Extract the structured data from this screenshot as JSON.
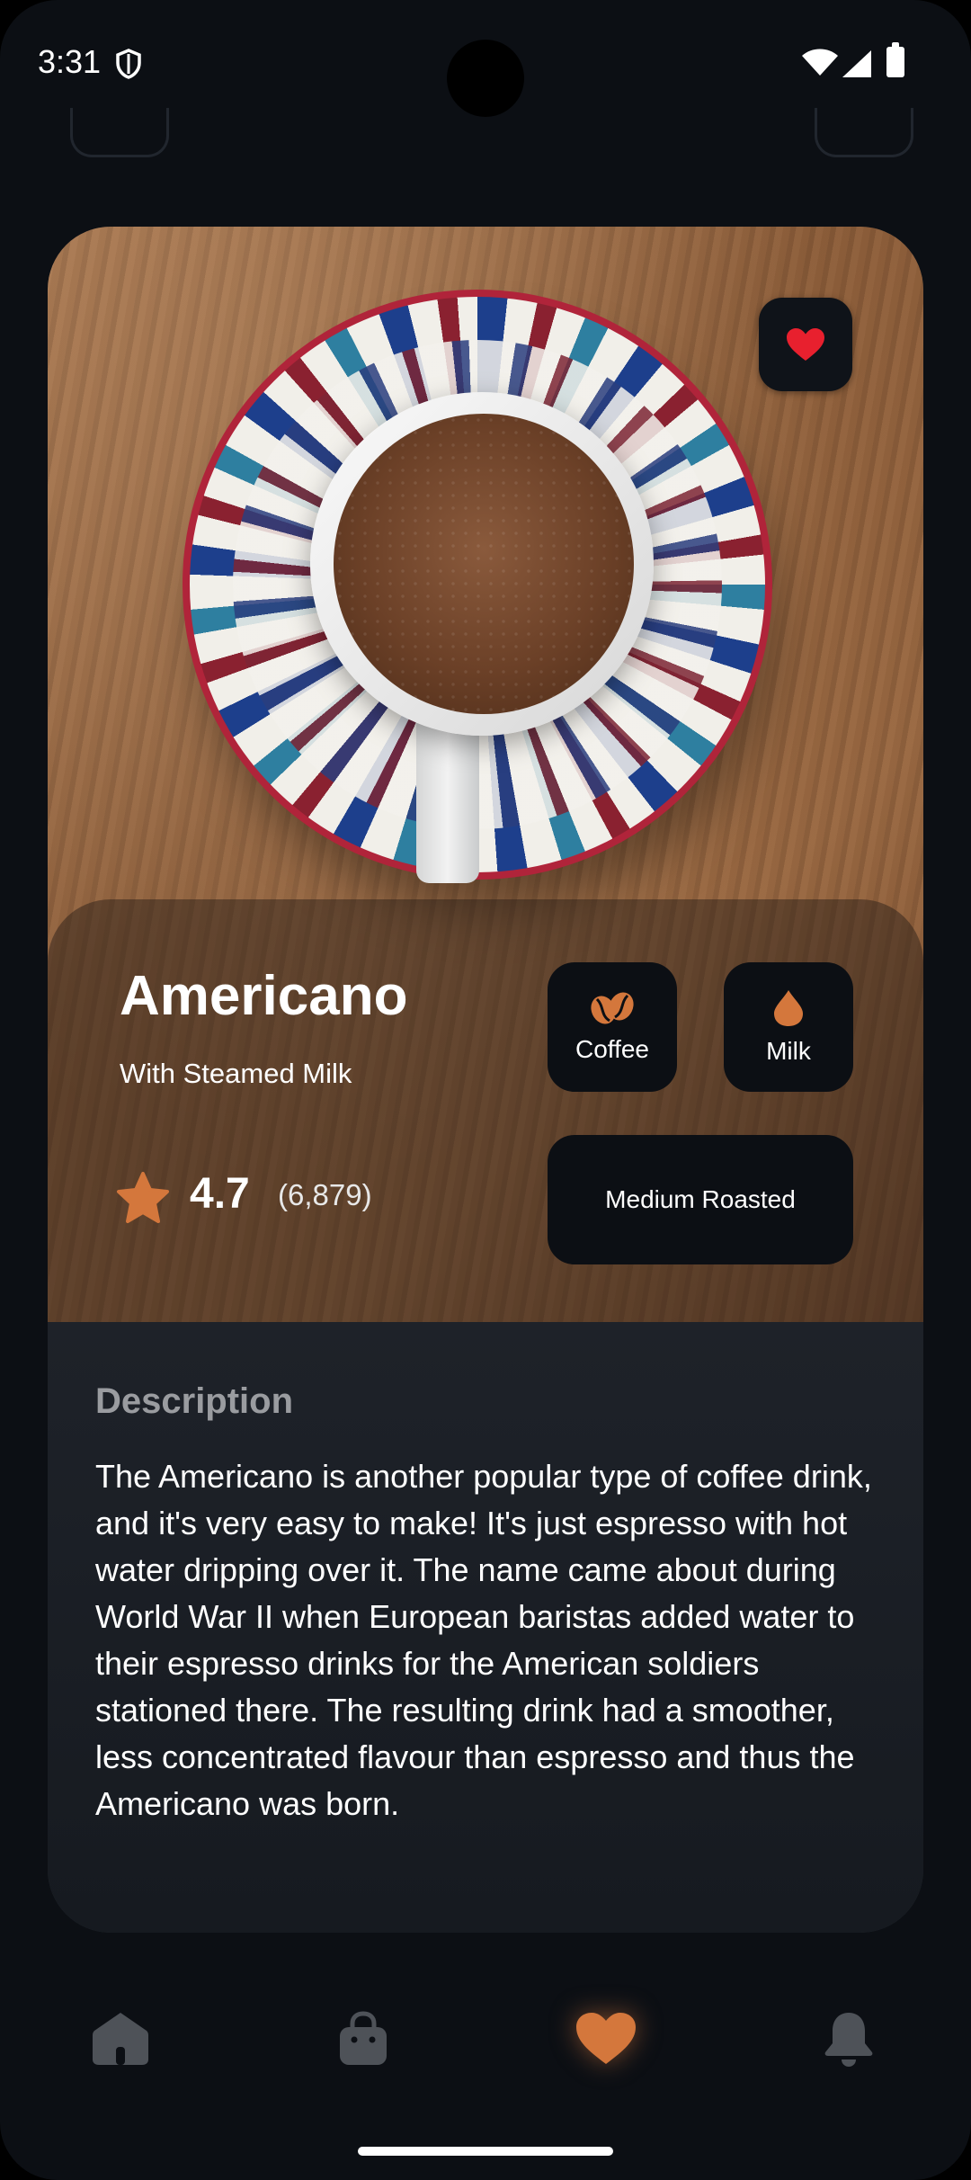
{
  "status_bar": {
    "time": "3:31"
  },
  "product": {
    "name": "Americano",
    "subtitle": "With Steamed Milk",
    "rating": "4.7",
    "rating_count": "(6,879)",
    "favorite": true
  },
  "chips": {
    "coffee_label": "Coffee",
    "milk_label": "Milk",
    "roast_label": "Medium Roasted"
  },
  "description": {
    "title": "Description",
    "text": "The Americano is another popular type of coffee drink, and it's very easy to make! It's just espresso with hot water dripping over it. The name came about during World War II when European baristas added water to their espresso drinks for the American soldiers stationed there. The resulting drink had a smoother, less concentrated flavour than espresso and thus the Americano was born."
  },
  "bottom_nav": {
    "items": [
      {
        "icon": "home-icon",
        "active": false
      },
      {
        "icon": "bag-icon",
        "active": false
      },
      {
        "icon": "heart-icon",
        "active": true
      },
      {
        "icon": "bell-icon",
        "active": false
      }
    ]
  },
  "colors": {
    "accent": "#d4773c",
    "favorite_red": "#e8202e",
    "background": "#0c0f14",
    "inactive_icon": "#4e5258"
  }
}
